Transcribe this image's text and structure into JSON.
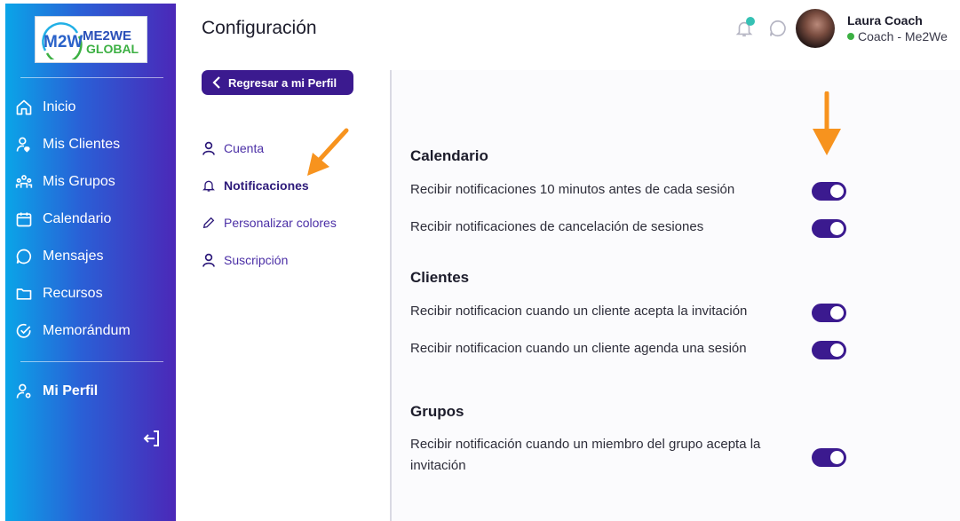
{
  "brand": {
    "logo_mark": "M2W",
    "logo_line1": "ME2WE",
    "logo_line2": "GLOBAL"
  },
  "sidebar": {
    "items": [
      {
        "label": "Inicio",
        "icon": "home-icon"
      },
      {
        "label": "Mis Clientes",
        "icon": "user-heart-icon"
      },
      {
        "label": "Mis Grupos",
        "icon": "group-icon"
      },
      {
        "label": "Calendario",
        "icon": "calendar-icon"
      },
      {
        "label": "Mensajes",
        "icon": "chat-icon"
      },
      {
        "label": "Recursos",
        "icon": "folder-icon"
      },
      {
        "label": "Memorándum",
        "icon": "check-circle-icon"
      }
    ],
    "profile": {
      "label": "Mi Perfil",
      "icon": "user-gear-icon"
    },
    "logout_icon": "logout-icon"
  },
  "header": {
    "title": "Configuración",
    "user_name": "Laura Coach",
    "user_role": "Coach - Me2We",
    "status_color": "#3cb043"
  },
  "back_button": {
    "label": "Regresar a mi Perfil"
  },
  "settings_menu": {
    "items": [
      {
        "label": "Cuenta",
        "icon": "user-icon",
        "active": false
      },
      {
        "label": "Notificaciones",
        "icon": "bell-icon",
        "active": true
      },
      {
        "label": "Personalizar colores",
        "icon": "pencil-icon",
        "active": false
      },
      {
        "label": "Suscripción",
        "icon": "user-icon",
        "active": false
      }
    ]
  },
  "sections": [
    {
      "title": "Calendario",
      "options": [
        {
          "label": "Recibir notificaciones 10 minutos antes de cada sesión",
          "enabled": true
        },
        {
          "label": "Recibir notificaciones de cancelación de sesiones",
          "enabled": true
        }
      ]
    },
    {
      "title": "Clientes",
      "options": [
        {
          "label": "Recibir notificacion cuando un cliente acepta la invitación",
          "enabled": true
        },
        {
          "label": "Recibir notificacion cuando un cliente agenda una sesión",
          "enabled": true
        }
      ]
    },
    {
      "title": "Grupos",
      "options": [
        {
          "label": "Recibir notificación cuando un miembro del grupo acepta la invitación",
          "enabled": true
        }
      ]
    }
  ],
  "colors": {
    "accent": "#3b1a8f",
    "annotation_arrow": "#f7931e",
    "notification_dot": "#35c1b4"
  }
}
